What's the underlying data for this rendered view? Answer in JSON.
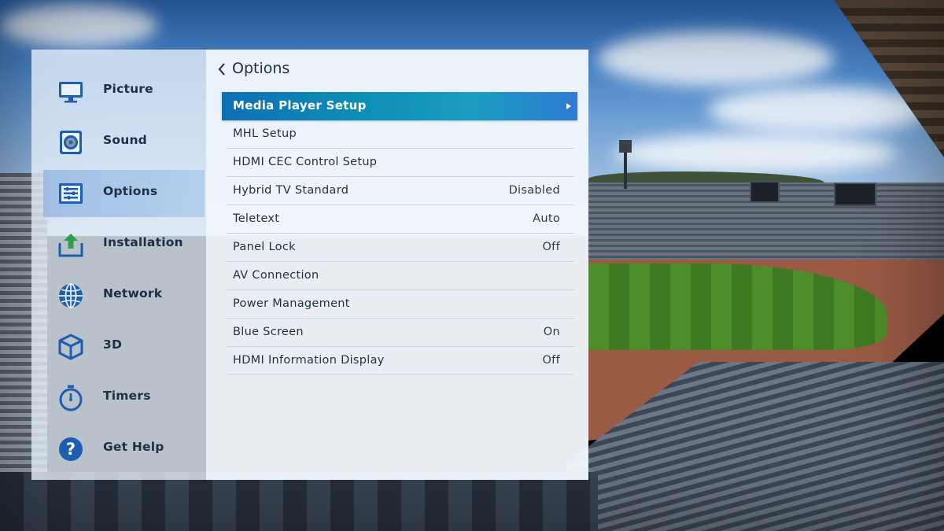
{
  "sidebar": {
    "items": [
      {
        "label": "Picture",
        "icon": "monitor-icon",
        "selected": false
      },
      {
        "label": "Sound",
        "icon": "speaker-icon",
        "selected": false
      },
      {
        "label": "Options",
        "icon": "options-icon",
        "selected": true
      },
      {
        "label": "Installation",
        "icon": "upload-icon",
        "selected": false
      },
      {
        "label": "Network",
        "icon": "globe-icon",
        "selected": false
      },
      {
        "label": "3D",
        "icon": "cube-icon",
        "selected": false
      },
      {
        "label": "Timers",
        "icon": "stopwatch-icon",
        "selected": false
      },
      {
        "label": "Get Help",
        "icon": "question-icon",
        "selected": false
      }
    ]
  },
  "main": {
    "title": "Options",
    "rows": [
      {
        "label": "Media Player Setup",
        "value": "",
        "highlighted": true
      },
      {
        "label": "MHL Setup",
        "value": ""
      },
      {
        "label": "HDMI CEC Control Setup",
        "value": ""
      },
      {
        "label": "Hybrid TV Standard",
        "value": "Disabled"
      },
      {
        "label": "Teletext",
        "value": "Auto"
      },
      {
        "label": "Panel Lock",
        "value": "Off"
      },
      {
        "label": "AV Connection",
        "value": ""
      },
      {
        "label": "Power Management",
        "value": ""
      },
      {
        "label": "Blue Screen",
        "value": "On"
      },
      {
        "label": "HDMI Information Display",
        "value": "Off"
      }
    ]
  },
  "colors": {
    "highlight": "#0d8fb6",
    "icon_blue": "#1d5fae",
    "text_dark": "#1f2f45"
  }
}
